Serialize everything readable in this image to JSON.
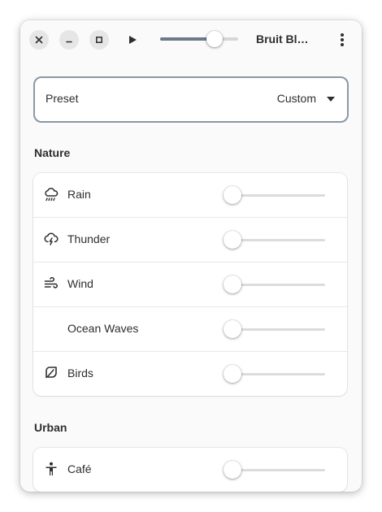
{
  "window": {
    "title": "Bruit Bl…",
    "volume_level": 0.7
  },
  "preset": {
    "label": "Preset",
    "value": "Custom"
  },
  "sections": [
    {
      "title": "Nature",
      "sounds": [
        {
          "label": "Rain",
          "icon": "rain-cloud-icon",
          "level": 0
        },
        {
          "label": "Thunder",
          "icon": "thunder-cloud-icon",
          "level": 0
        },
        {
          "label": "Wind",
          "icon": "wind-icon",
          "level": 0
        },
        {
          "label": "Ocean Waves",
          "icon": "",
          "level": 0
        },
        {
          "label": "Birds",
          "icon": "leaf-icon",
          "level": 0
        }
      ]
    },
    {
      "title": "Urban",
      "sounds": [
        {
          "label": "Café",
          "icon": "person-icon",
          "level": 0
        }
      ]
    }
  ],
  "colors": {
    "accent": "#6b7a8a",
    "preset_border": "#8a98a8",
    "background": "#fafafa",
    "card": "#ffffff"
  }
}
